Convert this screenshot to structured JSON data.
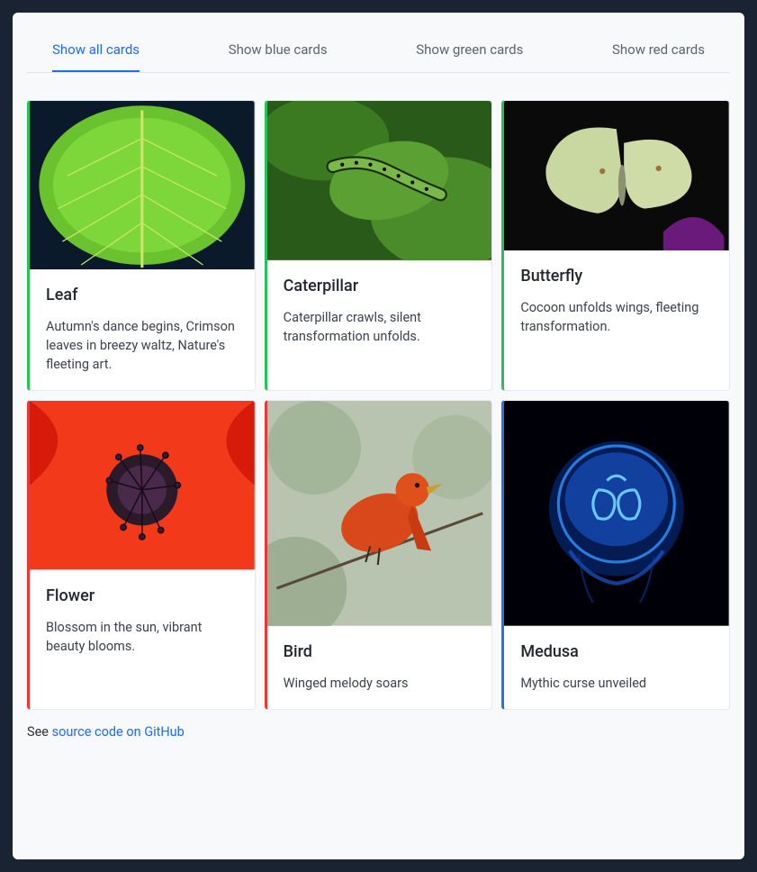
{
  "tabs": [
    {
      "label": "Show all cards",
      "active": true
    },
    {
      "label": "Show blue cards",
      "active": false
    },
    {
      "label": "Show green cards",
      "active": false
    },
    {
      "label": "Show red cards",
      "active": false
    }
  ],
  "cards": [
    {
      "color": "green",
      "title": "Leaf",
      "desc": "Autumn's dance begins, Crimson leaves in breezy waltz, Nature's fleeting art."
    },
    {
      "color": "green",
      "title": "Caterpillar",
      "desc": "Caterpillar crawls, silent transformation unfolds."
    },
    {
      "color": "green",
      "title": "Butterfly",
      "desc": "Cocoon unfolds wings, fleeting transformation."
    },
    {
      "color": "red",
      "title": "Flower",
      "desc": "Blossom in the sun, vibrant beauty blooms."
    },
    {
      "color": "red",
      "title": "Bird",
      "desc": "Winged melody soars"
    },
    {
      "color": "blue",
      "title": "Medusa",
      "desc": "Mythic curse unveiled"
    }
  ],
  "footer": {
    "prefix": "See ",
    "link_text": "source code on GitHub"
  },
  "image_heights": {
    "Leaf": 180,
    "Caterpillar": 170,
    "Butterfly": 160,
    "Flower": 180,
    "Bird": 240,
    "Medusa": 240
  }
}
